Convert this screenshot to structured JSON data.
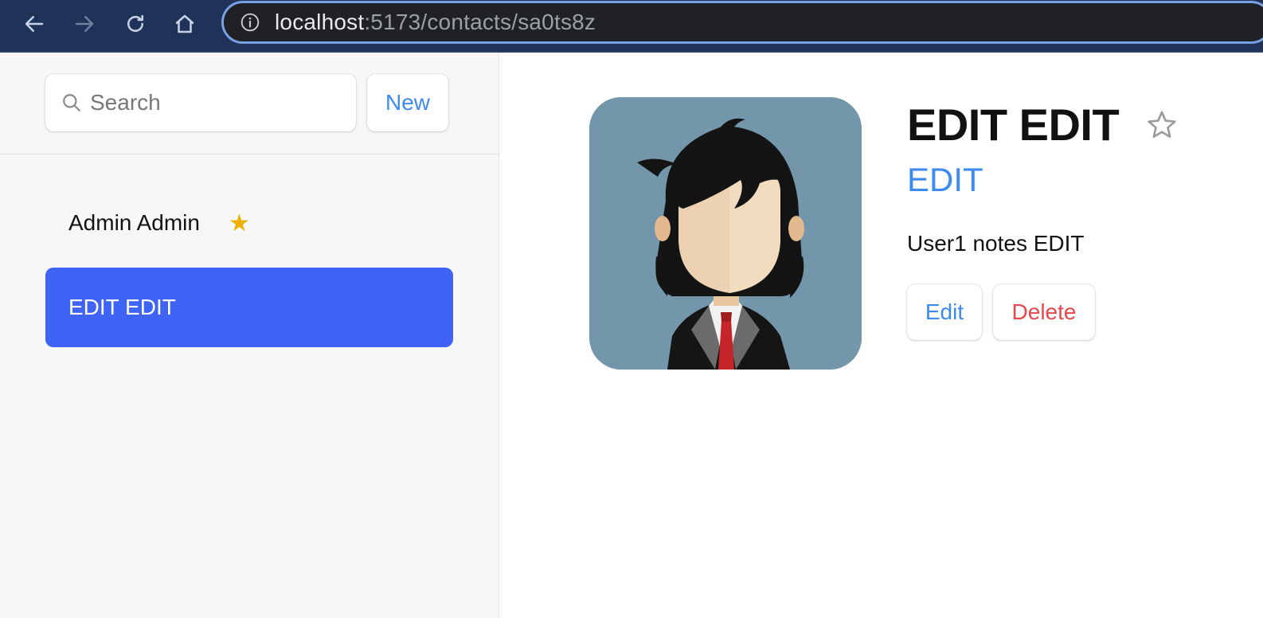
{
  "browser": {
    "url_host": "localhost",
    "url_path": ":5173/contacts/sa0ts8z",
    "icons": [
      "back-icon",
      "forward-icon",
      "reload-icon",
      "home-icon",
      "info-icon"
    ]
  },
  "sidebar": {
    "search": {
      "placeholder": "Search",
      "value": ""
    },
    "new_label": "New",
    "contacts": [
      {
        "name": "Admin Admin",
        "favorite": true,
        "star": "★",
        "active": false
      },
      {
        "name": "EDIT EDIT",
        "favorite": false,
        "active": true
      }
    ]
  },
  "contact": {
    "name": "EDIT EDIT",
    "twitter": "EDIT",
    "notes": "User1 notes EDIT",
    "favorite": false,
    "edit_label": "Edit",
    "delete_label": "Delete"
  },
  "colors": {
    "chrome": "#1f3358",
    "accent": "#3e8bf0",
    "active_item": "#3e63f5",
    "danger": "#e5484d",
    "star": "#eeb004"
  }
}
